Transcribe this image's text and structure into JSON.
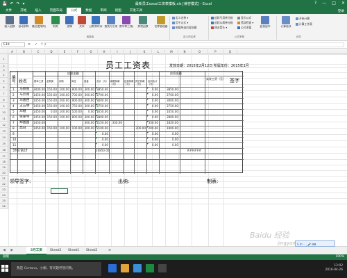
{
  "window": {
    "title": "最新员工excel工资表模板.xls [兼容模式] - Excel",
    "qat": [
      "💾",
      "↶",
      "↷",
      "▾"
    ],
    "win_buttons": [
      "?",
      "—",
      "□",
      "✕"
    ]
  },
  "ribbon": {
    "tabs": [
      "文件",
      "开始",
      "插入",
      "页面布局",
      "公式",
      "数据",
      "审阅",
      "视图",
      "开发工具"
    ],
    "active_tab": "公式",
    "login": "登录",
    "buttons": [
      {
        "label": "插入函数",
        "color": "#5b6f8c"
      },
      {
        "label": "自动求和",
        "color": "#3f6fb8"
      },
      {
        "label": "最近使用的函数",
        "color": "#d28a2a"
      },
      {
        "label": "财务",
        "color": "#2d8f4f"
      },
      {
        "label": "逻辑",
        "color": "#3f6fb8"
      },
      {
        "label": "文本",
        "color": "#c04a3a"
      },
      {
        "label": "日期和时间",
        "color": "#3a76c0"
      },
      {
        "label": "查找与引用",
        "color": "#5a80c0"
      },
      {
        "label": "数学和三角函数",
        "color": "#8a4ab0"
      },
      {
        "label": "其他函数",
        "color": "#4a8a7a"
      },
      {
        "label": "名称管理器",
        "color": "#c09a2a"
      }
    ],
    "name_items": [
      "定义名称 ▾",
      "用于公式 ▾",
      "根据所选内容创建"
    ],
    "audit_items": [
      "追踪引用单元格",
      "追踪从属单元格",
      "移去箭头 ▾",
      "显示公式",
      "错误检查 ▾",
      "公式求值"
    ],
    "watch_label": "监视窗口",
    "calc_label": "计算选项",
    "calc_items": [
      "开始计算",
      "计算工作表"
    ],
    "groups": [
      "函数库",
      "定义的名称",
      "公式审核",
      "计算"
    ]
  },
  "formula_bar": {
    "name_box": "E19",
    "fx": "✕ ✓ fx",
    "value": ""
  },
  "columns": [
    "A",
    "B",
    "C",
    "D",
    "E",
    "F",
    "G",
    "H",
    "I",
    "J",
    "K",
    "L",
    "M",
    "N",
    "O",
    "P",
    "Q"
  ],
  "rows": [
    "1",
    "2",
    "3",
    "4",
    "5",
    "6",
    "7",
    "8",
    "9",
    "10",
    "11",
    "12",
    "13",
    "14",
    "15",
    "16",
    "17",
    "18",
    "19",
    "20",
    "21",
    "22",
    "23",
    "24",
    "25",
    "26"
  ],
  "sheet": {
    "title": "员工工资表",
    "date_label": "发放日期：",
    "date_value": "2015年2月12日 所属年份：2015年1月",
    "header": {
      "id": "编号",
      "name": "姓名",
      "payable": "应发金额",
      "deduct": "应扣金额",
      "net": "实发工资（元）",
      "sign": "签字",
      "sub": [
        "基本工资",
        "全勤奖",
        "补助",
        "岗位",
        "奖金",
        "合计（元）",
        "病假扣款（元）",
        "迟到扣款（元）",
        "其它扣款（元）",
        "应扣合计（元）"
      ]
    },
    "records": [
      {
        "id": "1",
        "name": "马丽丽",
        "vals": [
          "3000.00",
          "150.00",
          "100.00",
          "800.00",
          "300.00",
          "3850.00",
          "",
          "",
          "",
          "0.00",
          "3850.00"
        ]
      },
      {
        "id": "2",
        "name": "马云南",
        "vals": [
          "1450.00",
          "150.00",
          "100.00",
          "700.00",
          "300.00",
          "2700.00",
          "",
          "",
          "",
          "0.00",
          "2700.00"
        ]
      },
      {
        "id": "3",
        "name": "马国西",
        "vals": [
          "1450.00",
          "150.00",
          "200.00",
          "900.00",
          "300.00",
          "3000.00",
          "",
          "",
          "",
          "0.00",
          "3000.00"
        ]
      },
      {
        "id": "4",
        "name": "王五明",
        "vals": [
          "1450.00",
          "150.00",
          "100.00",
          "750.00",
          "300.00",
          "2750.00",
          "",
          "",
          "",
          "0.00",
          "2750.00"
        ]
      },
      {
        "id": "5",
        "name": "邓健",
        "vals": [
          "1450.00",
          "0.00",
          "100.00",
          "100.00",
          "0.00",
          "1650.00",
          "",
          "",
          "",
          "0.00",
          "1650.00"
        ]
      },
      {
        "id": "6",
        "name": "张爱琴",
        "vals": [
          "1450.00",
          "150.00",
          "100.00",
          "800.00",
          "300.00",
          "2800.00",
          "",
          "",
          "",
          "0.00",
          "2800.00"
        ]
      },
      {
        "id": "7",
        "name": "郑国国",
        "vals": [
          "1450.00",
          "",
          "",
          "",
          "300.00",
          "2150.00",
          "330.00",
          "",
          "",
          "330.00",
          "1820.00"
        ]
      },
      {
        "id": "8",
        "name": "高日",
        "vals": [
          "1450.00",
          "150.00",
          "100.00",
          "100.00",
          "300.00",
          "2100.00",
          "",
          "",
          "200.00",
          "200.00",
          "1900.00"
        ]
      },
      {
        "id": "9",
        "name": "",
        "vals": [
          "",
          "",
          "",
          "",
          "",
          "0.00",
          "",
          "",
          "",
          "0.00",
          "0.00"
        ]
      },
      {
        "id": "10",
        "name": "",
        "vals": [
          "",
          "",
          "",
          "",
          "",
          "0.00",
          "",
          "",
          "",
          "0.00",
          "0.00"
        ]
      },
      {
        "id": "11",
        "name": "",
        "vals": [
          "",
          "",
          "",
          "",
          "",
          "0.00",
          "",
          "",
          "",
          "0.00",
          "0.00"
        ]
      }
    ],
    "subtotal_label": "分栏合计",
    "subtotal_total": "20850.00",
    "subtotal_net": "######",
    "footer": {
      "leader": "领导签字:",
      "cashier": "出纳:",
      "maker": "制表:"
    }
  },
  "sheet_tabs": {
    "nav": "◀ ▶",
    "tabs": [
      "5月工资",
      "Sheet3",
      "Sheet1",
      "Sheet2"
    ],
    "add": "⊕",
    "active": "5月工资"
  },
  "status": {
    "ready": "就绪",
    "zoom": "100%"
  },
  "taskbar": {
    "cortana": "我是 Cortana，小娜。有问题尽管问我。",
    "time": "12:02",
    "date": "2016-04-26",
    "apps": [
      "#2a6fd6",
      "#e0a43a",
      "#3a8fd6",
      "#1b8a3e",
      "#444"
    ]
  },
  "watermark": {
    "text": "Baidu 经验",
    "sub": "jingyan.baidu.com"
  },
  "ime_label": "S 中 ◦ , 🎤 ⌨"
}
